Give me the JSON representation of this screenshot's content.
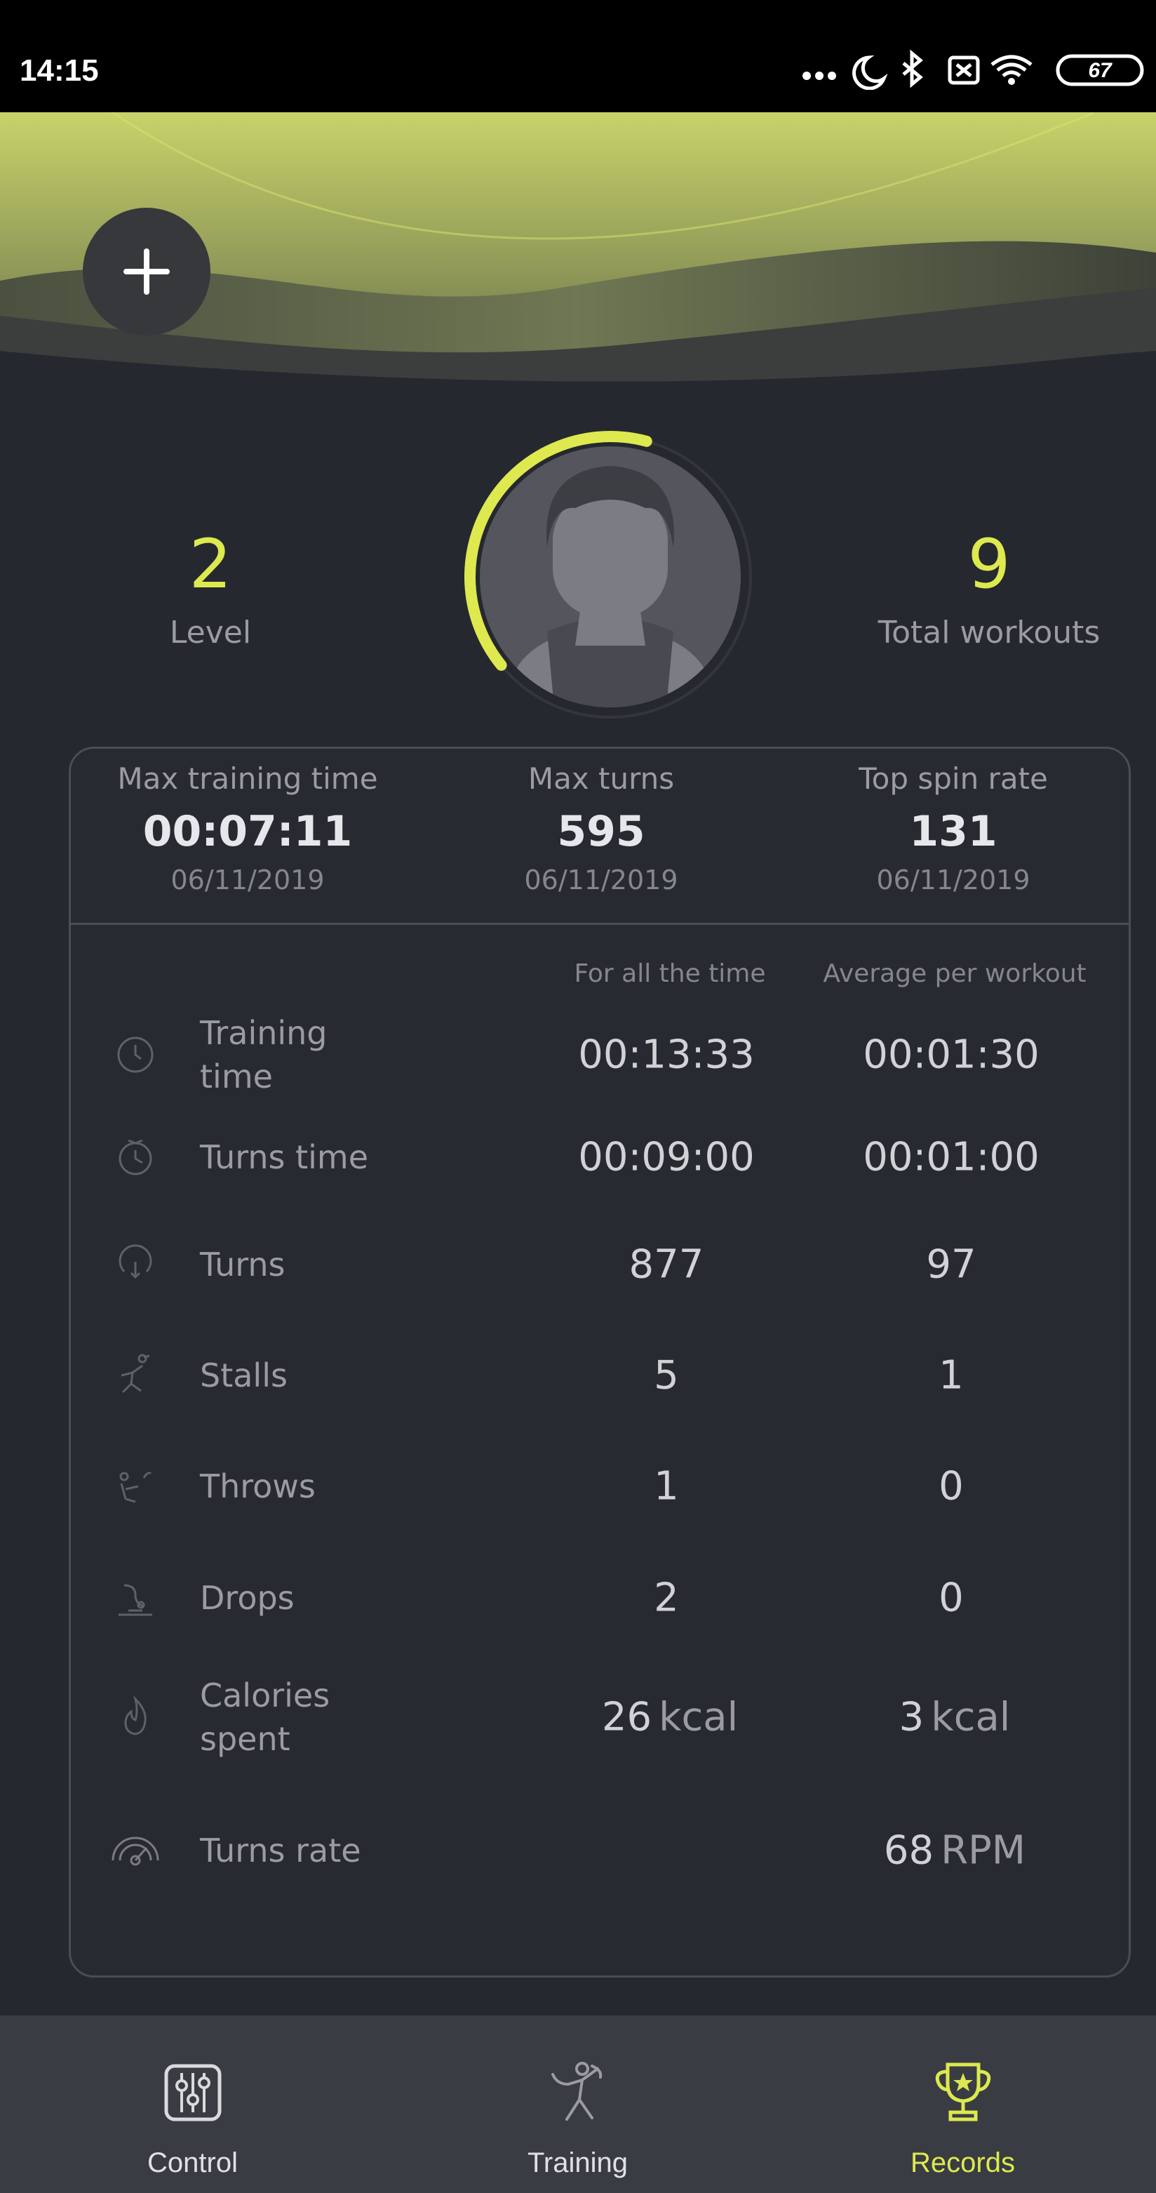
{
  "status_bar": {
    "time": "14:15",
    "battery": "67"
  },
  "profile": {
    "level_value": "2",
    "level_label": "Level",
    "workouts_value": "9",
    "workouts_label": "Total workouts",
    "progress_fraction": 0.4
  },
  "records": [
    {
      "title": "Max training time",
      "value": "00:07:11",
      "date": "06/11/2019"
    },
    {
      "title": "Max turns",
      "value": "595",
      "date": "06/11/2019"
    },
    {
      "title": "Top spin rate",
      "value": "131",
      "date": "06/11/2019"
    }
  ],
  "table": {
    "col_all": "For all the time",
    "col_avg": "Average per workout",
    "rows": [
      {
        "icon": "clock-icon",
        "label": "Training time",
        "all": "00:13:33",
        "all_unit": "",
        "avg": "00:01:30",
        "avg_unit": ""
      },
      {
        "icon": "timer-icon",
        "label": "Turns time",
        "all": "00:09:00",
        "all_unit": "",
        "avg": "00:01:00",
        "avg_unit": ""
      },
      {
        "icon": "turns-icon",
        "label": "Turns",
        "all": "877",
        "all_unit": "",
        "avg": "97",
        "avg_unit": ""
      },
      {
        "icon": "stall-icon",
        "label": "Stalls",
        "all": "5",
        "all_unit": "",
        "avg": "1",
        "avg_unit": ""
      },
      {
        "icon": "throw-icon",
        "label": "Throws",
        "all": "1",
        "all_unit": "",
        "avg": "0",
        "avg_unit": ""
      },
      {
        "icon": "drop-icon",
        "label": "Drops",
        "all": "2",
        "all_unit": "",
        "avg": "0",
        "avg_unit": ""
      },
      {
        "icon": "fire-icon",
        "label": "Calories spent",
        "all": "26",
        "all_unit": "kcal",
        "avg": "3",
        "avg_unit": "kcal"
      },
      {
        "icon": "speedometer-icon",
        "label": "Turns rate",
        "all": "",
        "all_unit": "",
        "avg": "68",
        "avg_unit": "RPM"
      }
    ]
  },
  "nav": [
    {
      "label": "Control",
      "icon": "sliders-icon",
      "active": false
    },
    {
      "label": "Training",
      "icon": "dancer-icon",
      "active": false
    },
    {
      "label": "Records",
      "icon": "trophy-icon",
      "active": true
    }
  ],
  "colors": {
    "accent": "#dde94e",
    "background": "#26282f",
    "navbar": "#3a3c43"
  }
}
